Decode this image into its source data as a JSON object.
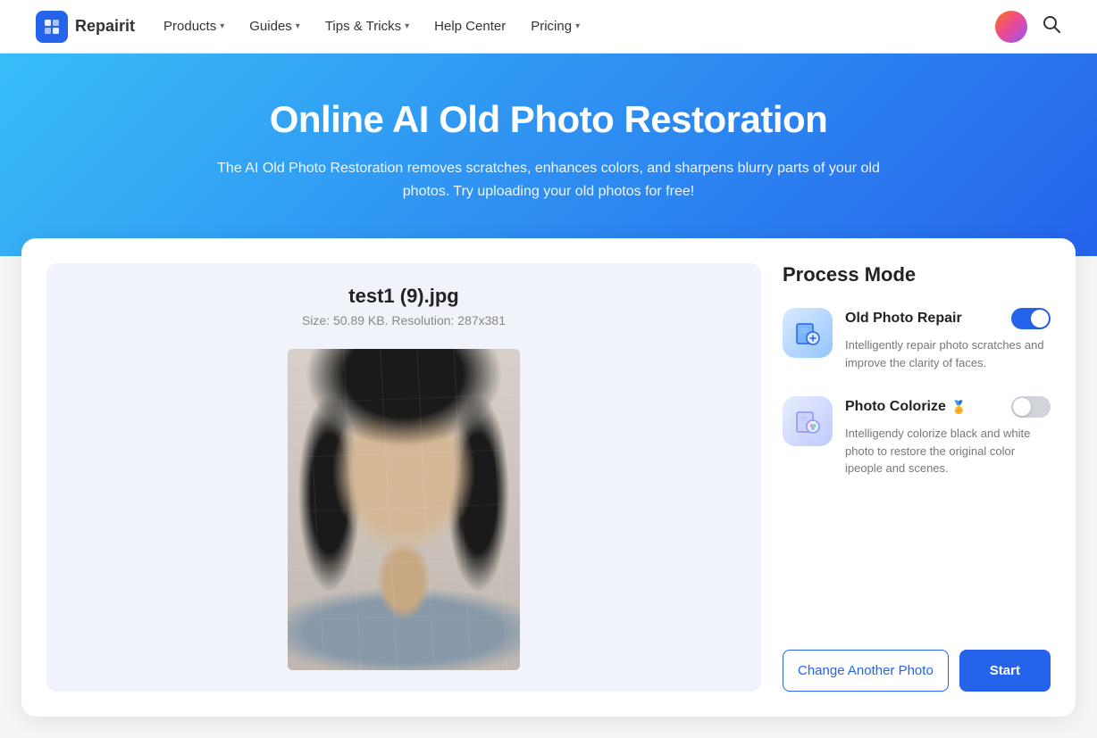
{
  "navbar": {
    "logo_text": "Repairit",
    "logo_icon": "R",
    "nav_items": [
      {
        "label": "Products",
        "has_chevron": true
      },
      {
        "label": "Guides",
        "has_chevron": true
      },
      {
        "label": "Tips & Tricks",
        "has_chevron": true
      },
      {
        "label": "Help Center",
        "has_chevron": false
      },
      {
        "label": "Pricing",
        "has_chevron": true
      }
    ]
  },
  "hero": {
    "title": "Online AI Old Photo Restoration",
    "subtitle": "The AI Old Photo Restoration removes scratches, enhances colors, and sharpens blurry parts of your old photos. Try uploading your old photos for free!"
  },
  "file_panel": {
    "filename": "test1 (9).jpg",
    "meta": "Size: 50.89 KB. Resolution: 287x381"
  },
  "process_mode": {
    "title": "Process Mode",
    "modes": [
      {
        "name": "Old Photo Repair",
        "icon": "🖼️",
        "description": "Intelligently repair photo scratches and improve the clarity of faces.",
        "enabled": true,
        "is_pro": false
      },
      {
        "name": "Photo Colorize",
        "icon": "🎨",
        "description": "Intelligendy colorize black and white photo to restore the original color ipeople and scenes.",
        "enabled": false,
        "is_pro": true
      }
    ]
  },
  "actions": {
    "change_label": "Change Another Photo",
    "start_label": "Start"
  }
}
